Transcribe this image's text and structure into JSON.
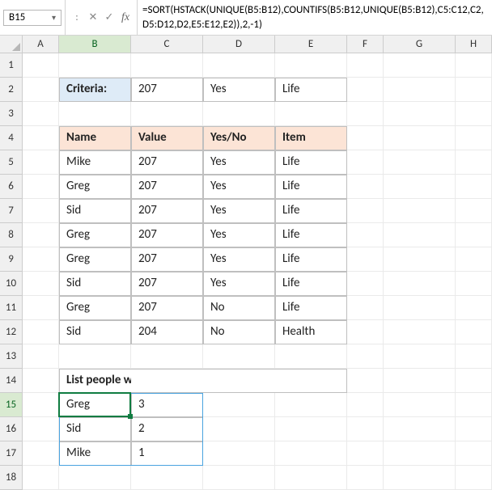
{
  "nameBox": "B15",
  "formula": "=SORT(HSTACK(UNIQUE(B5:B12),COUNTIFS(B5:B12,UNIQUE(B5:B12),C5:C12,C2,D5:D12,D2,E5:E12,E2)),2,-1)",
  "colHeaders": [
    "A",
    "B",
    "C",
    "D",
    "E",
    "F",
    "G",
    "H"
  ],
  "rowHeaders": [
    "1",
    "2",
    "3",
    "4",
    "5",
    "6",
    "7",
    "8",
    "9",
    "10",
    "11",
    "12",
    "13",
    "14",
    "15",
    "16",
    "17",
    "18"
  ],
  "criteria": {
    "label": "Criteria:",
    "c": "207",
    "d": "Yes",
    "e": "Life"
  },
  "table": {
    "headers": {
      "b": "Name",
      "c": "Value",
      "d": "Yes/No",
      "e": "Item"
    },
    "rows": [
      {
        "b": "Mike",
        "c": "207",
        "d": "Yes",
        "e": "Life"
      },
      {
        "b": "Greg",
        "c": "207",
        "d": "Yes",
        "e": "Life"
      },
      {
        "b": "Sid",
        "c": "207",
        "d": "Yes",
        "e": "Life"
      },
      {
        "b": "Greg",
        "c": "207",
        "d": "Yes",
        "e": "Life"
      },
      {
        "b": "Greg",
        "c": "207",
        "d": "Yes",
        "e": "Life"
      },
      {
        "b": "Sid",
        "c": "207",
        "d": "Yes",
        "e": "Life"
      },
      {
        "b": "Greg",
        "c": "207",
        "d": "No",
        "e": "Life"
      },
      {
        "b": "Sid",
        "c": "204",
        "d": "No",
        "e": "Health"
      }
    ]
  },
  "resultsTitle": "List people with the highest scores",
  "results": [
    {
      "name": "Greg",
      "count": "3"
    },
    {
      "name": "Sid",
      "count": "2"
    },
    {
      "name": "Mike",
      "count": "1"
    }
  ],
  "icons": {
    "cancel": "✕",
    "confirm": "✓",
    "fx": "fx",
    "dropdown": "▾",
    "divider": ":"
  }
}
